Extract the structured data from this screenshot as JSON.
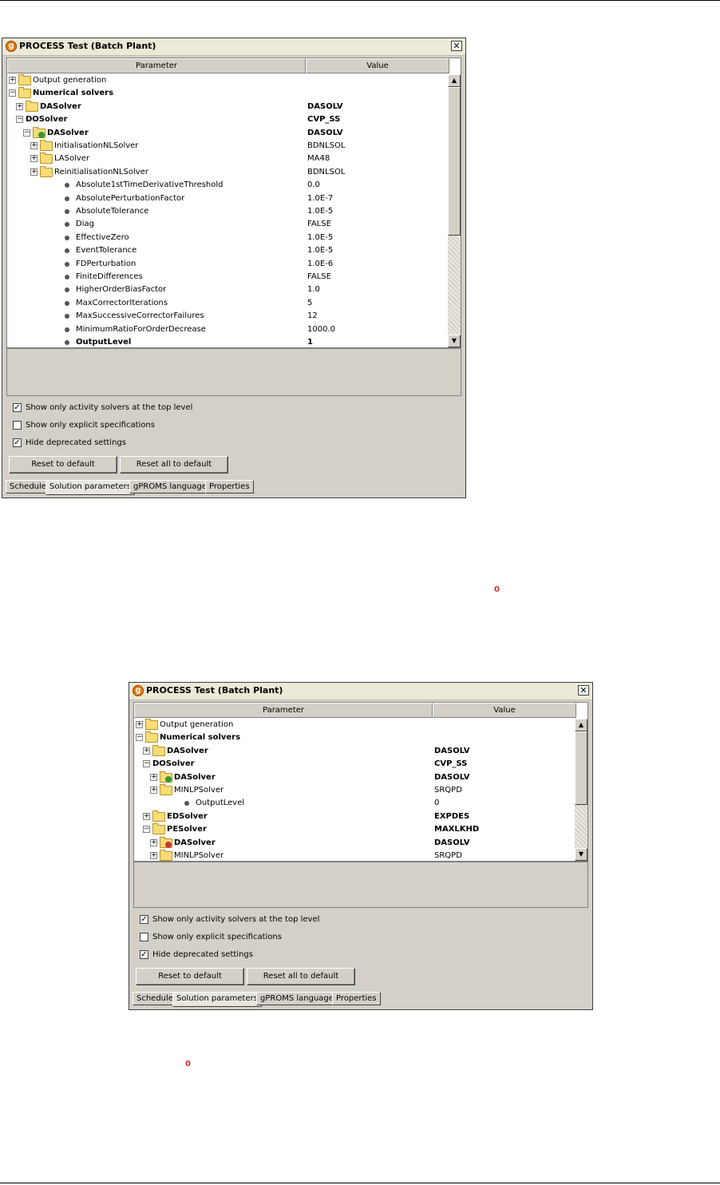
{
  "window1": {
    "title": "PROCESS Test (Batch Plant)",
    "close": "✕",
    "columns": [
      "Parameter",
      "Value"
    ],
    "rows": [
      {
        "label": "Output generation",
        "value": "",
        "bold": false,
        "expander": "+",
        "icon": "folder"
      },
      {
        "label": "Numerical solvers",
        "value": "",
        "bold": true,
        "expander": "-",
        "icon": "folder"
      },
      {
        "label": "DASolver",
        "value": "DASOLV",
        "bold": true,
        "expander": "+",
        "icon": "folder"
      },
      {
        "label": "DOSolver",
        "value": "CVP_SS",
        "bold": true,
        "expander": "-",
        "icon": "none"
      },
      {
        "label": "DASolver",
        "value": "DASOLV",
        "bold": true,
        "expander": "-",
        "icon": "folder-green"
      },
      {
        "label": "InitialisationNLSolver",
        "value": "BDNLSOL",
        "bold": false,
        "expander": "+",
        "icon": "folder"
      },
      {
        "label": "LASolver",
        "value": "MA48",
        "bold": false,
        "expander": "+",
        "icon": "folder"
      },
      {
        "label": "ReinitialisationNLSolver",
        "value": "BDNLSOL",
        "bold": false,
        "expander": "+",
        "icon": "folder"
      },
      {
        "label": "Absolute1stTimeDerivativeThreshold",
        "value": "0.0",
        "bold": false,
        "expander": "",
        "icon": "dot"
      },
      {
        "label": "AbsolutePerturbationFactor",
        "value": "1.0E-7",
        "bold": false,
        "expander": "",
        "icon": "dot"
      },
      {
        "label": "AbsoluteTolerance",
        "value": "1.0E-5",
        "bold": false,
        "expander": "",
        "icon": "dot"
      },
      {
        "label": "Diag",
        "value": "FALSE",
        "bold": false,
        "expander": "",
        "icon": "dot"
      },
      {
        "label": "EffectiveZero",
        "value": "1.0E-5",
        "bold": false,
        "expander": "",
        "icon": "dot"
      },
      {
        "label": "EventTolerance",
        "value": "1.0E-5",
        "bold": false,
        "expander": "",
        "icon": "dot"
      },
      {
        "label": "FDPerturbation",
        "value": "1.0E-6",
        "bold": false,
        "expander": "",
        "icon": "dot"
      },
      {
        "label": "FiniteDifferences",
        "value": "FALSE",
        "bold": false,
        "expander": "",
        "icon": "dot"
      },
      {
        "label": "HigherOrderBiasFactor",
        "value": "1.0",
        "bold": false,
        "expander": "",
        "icon": "dot"
      },
      {
        "label": "MaxCorrectorIterations",
        "value": "5",
        "bold": false,
        "expander": "",
        "icon": "dot"
      },
      {
        "label": "MaxSuccessiveCorrectorFailures",
        "value": "12",
        "bold": false,
        "expander": "",
        "icon": "dot"
      },
      {
        "label": "MinimumRatioForOrderDecrease",
        "value": "1000.0",
        "bold": false,
        "expander": "",
        "icon": "dot"
      },
      {
        "label": "OutputLevel",
        "value": "1",
        "bold": true,
        "expander": "",
        "icon": "dot"
      }
    ],
    "checkboxes": [
      {
        "label": "Show only activity solvers at the top level",
        "checked": true
      },
      {
        "label": "Show only explicit specifications",
        "checked": false
      },
      {
        "label": "Hide deprecated settings",
        "checked": true
      }
    ],
    "buttons": [
      "Reset to default",
      "Reset all to default"
    ],
    "tabs": [
      "Schedule",
      "Solution parameters",
      "gPROMS language",
      "Properties"
    ],
    "active_tab": "Solution parameters"
  },
  "window2": {
    "title": "PROCESS Test (Batch Plant)",
    "close": "✕",
    "columns": [
      "Parameter",
      "Value"
    ],
    "rows": [
      {
        "label": "Output generation",
        "value": "",
        "bold": false,
        "expander": "+",
        "icon": "folder"
      },
      {
        "label": "Numerical solvers",
        "value": "",
        "bold": true,
        "expander": "-",
        "icon": "folder"
      },
      {
        "label": "DASolver",
        "value": "DASOLV",
        "bold": true,
        "expander": "+",
        "icon": "folder"
      },
      {
        "label": "DOSolver",
        "value": "CVP_SS",
        "bold": true,
        "expander": "-",
        "icon": "none"
      },
      {
        "label": "DASolver",
        "value": "DASOLV",
        "bold": true,
        "expander": "+",
        "icon": "folder-green"
      },
      {
        "label": "MINLPSolver",
        "value": "SRQPD",
        "bold": false,
        "expander": "+",
        "icon": "folder"
      },
      {
        "label": "OutputLevel",
        "value": "0",
        "bold": false,
        "expander": "",
        "icon": "dot"
      },
      {
        "label": "EDSolver",
        "value": "EXPDES",
        "bold": true,
        "expander": "+",
        "icon": "folder"
      },
      {
        "label": "PESolver",
        "value": "MAXLKHD",
        "bold": true,
        "expander": "-",
        "icon": "folder"
      },
      {
        "label": "DASolver",
        "value": "DASOLV",
        "bold": true,
        "expander": "+",
        "icon": "folder-red"
      },
      {
        "label": "MINLPSolver",
        "value": "SRQPD",
        "bold": false,
        "expander": "+",
        "icon": "folder"
      }
    ],
    "checkboxes": [
      {
        "label": "Show only activity solvers at the top level",
        "checked": true
      },
      {
        "label": "Show only explicit specifications",
        "checked": false
      },
      {
        "label": "Hide deprecated settings",
        "checked": true
      }
    ],
    "buttons": [
      "Reset to default",
      "Reset all to default"
    ],
    "tabs": [
      "Schedule",
      "Solution parameters",
      "gPROMS language",
      "Properties"
    ],
    "active_tab": "Solution parameters"
  },
  "markers": [
    "0",
    "0"
  ],
  "colors": {
    "window_bg": "#d4d0c8",
    "folder": "#f8dc76",
    "active_solver": "#2f9a2f",
    "inactive_solver": "#d03030",
    "marker": "#d03030"
  }
}
